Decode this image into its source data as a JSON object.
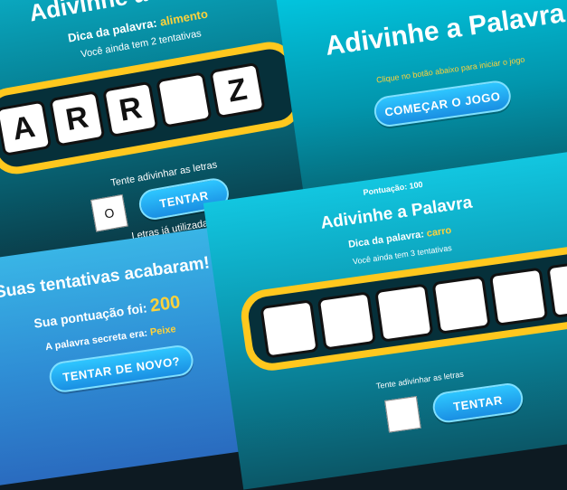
{
  "game_tl": {
    "title": "Adivinhe a Palavra",
    "hint_label": "Dica da palavra:",
    "hint_value": "alimento",
    "attempts": "Você ainda tem 2 tentativas",
    "tiles": [
      "A",
      "R",
      "R",
      "",
      "Z"
    ],
    "prompt": "Tente adivinhar as letras",
    "input_value": "O",
    "try_label": "TENTAR",
    "used_letters": "Letras já utilizadas:"
  },
  "start": {
    "title": "Adivinhe a Palavra",
    "instruction": "Clique no botão abaixo para iniciar o jogo",
    "start_label": "COMEÇAR O JOGO"
  },
  "game_new": {
    "score": "Pontuação: 100",
    "title": "Adivinhe a Palavra",
    "hint_label": "Dica da palavra:",
    "hint_value": "carro",
    "attempts": "Você ainda tem 3 tentativas",
    "tiles": [
      "",
      "",
      "",
      "",
      "",
      ""
    ],
    "prompt": "Tente adivinhar as letras",
    "try_label": "TENTAR"
  },
  "gameover": {
    "title": "Suas tentativas acabaram!",
    "score_label": "Sua pontuação foi:",
    "score_value": "200",
    "secret_label": "A palavra secreta era:",
    "secret_value": "Peixe",
    "retry_label": "TENTAR DE NOVO?"
  },
  "colors": {
    "accent_yellow": "#ffc81e",
    "button_blue": "#1a8fe3",
    "teal": "#0296ad"
  }
}
